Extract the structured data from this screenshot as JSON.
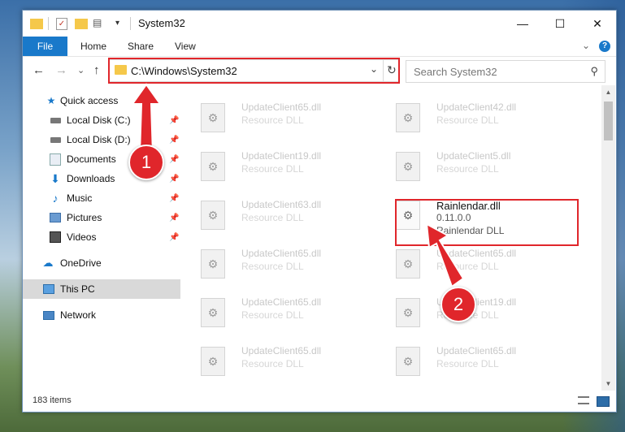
{
  "window": {
    "title": "System32",
    "minimize": "—",
    "maximize": "☐",
    "close": "✕"
  },
  "ribbon": {
    "tabs": [
      "File",
      "Home",
      "Share",
      "View"
    ],
    "collapse": "⌄",
    "help": "?"
  },
  "navigation": {
    "back": "←",
    "forward": "→",
    "recent": "⌄",
    "up": "↑"
  },
  "address": {
    "path": "C:\\Windows\\System32",
    "dropdown": "⌄",
    "refresh": "↻"
  },
  "search": {
    "placeholder": "Search System32",
    "icon": "search-icon"
  },
  "sidebar": {
    "items": [
      {
        "label": "Quick access",
        "icon": "star-icon",
        "pinned": false
      },
      {
        "label": "Local Disk (C:)",
        "icon": "drive-icon",
        "pinned": true
      },
      {
        "label": "Local Disk (D:)",
        "icon": "drive-icon",
        "pinned": true
      },
      {
        "label": "Documents",
        "icon": "documents-icon",
        "pinned": true
      },
      {
        "label": "Downloads",
        "icon": "download-icon",
        "pinned": true
      },
      {
        "label": "Music",
        "icon": "music-icon",
        "pinned": true
      },
      {
        "label": "Pictures",
        "icon": "pictures-icon",
        "pinned": true
      },
      {
        "label": "Videos",
        "icon": "videos-icon",
        "pinned": true
      },
      {
        "label": "OneDrive",
        "icon": "cloud-icon",
        "pinned": false
      },
      {
        "label": "This PC",
        "icon": "computer-icon",
        "pinned": false,
        "selected": true
      },
      {
        "label": "Network",
        "icon": "network-icon",
        "pinned": false
      }
    ]
  },
  "files": [
    {
      "name": "UpdateClient65.dll",
      "type": "Resource DLL"
    },
    {
      "name": "UpdateClient42.dll",
      "type": "Resource DLL"
    },
    {
      "name": "UpdateClient19.dll",
      "type": "Resource DLL"
    },
    {
      "name": "UpdateClient5.dll",
      "type": "Resource DLL"
    },
    {
      "name": "UpdateClient63.dll",
      "type": "Resource DLL"
    },
    {
      "name": "Rainlendar.dll",
      "version": "0.11.0.0",
      "description": "Rainlendar DLL",
      "highlighted": true
    },
    {
      "name": "UpdateClient65.dll",
      "type": "Resource DLL"
    },
    {
      "name": "UpdateClient65.dll",
      "type": "Resource DLL"
    },
    {
      "name": "UpdateClient65.dll",
      "type": "Resource DLL"
    },
    {
      "name": "UpdateClient19.dll",
      "type": "Resource DLL"
    },
    {
      "name": "UpdateClient65.dll",
      "type": "Resource DLL"
    },
    {
      "name": "UpdateClient65.dll",
      "type": "Resource DLL"
    }
  ],
  "status": {
    "item_count": "183 items"
  },
  "annotations": {
    "step1": "1",
    "step2": "2",
    "color": "#e0262b"
  }
}
